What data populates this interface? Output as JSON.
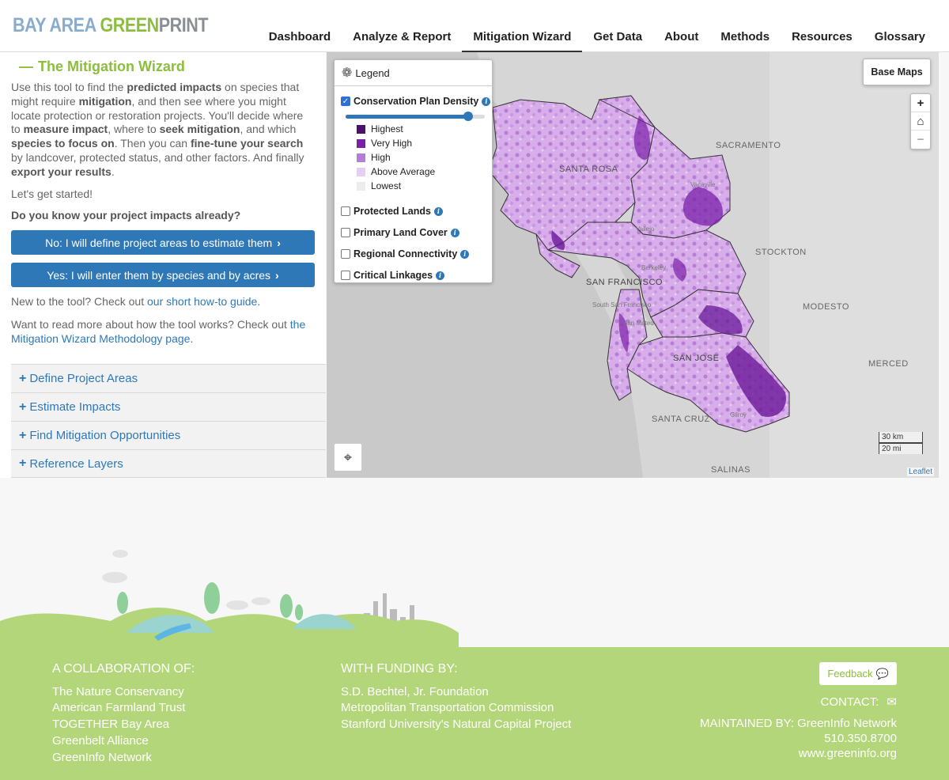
{
  "header": {
    "logo": {
      "part1": "BAY AREA ",
      "part2": "GREEN",
      "part3": "PRINT"
    },
    "nav": [
      {
        "label": "Dashboard"
      },
      {
        "label": "Analyze & Report"
      },
      {
        "label": "Mitigation Wizard"
      },
      {
        "label": "Get Data"
      },
      {
        "label": "About"
      },
      {
        "label": "Methods"
      },
      {
        "label": "Resources"
      },
      {
        "label": "Glossary"
      }
    ],
    "active_nav": "Mitigation Wizard"
  },
  "sidebar": {
    "title": "The Mitigation Wizard",
    "intro": {
      "t1": "Use this tool to find the ",
      "b1": "predicted impacts",
      "t2": " on species that might require ",
      "b2": "mitigation",
      "t3": ", and then see where you might locate protection or restoration projects. You'll decide where to ",
      "b3": "measure impact",
      "t4": ", where to ",
      "b4": "seek mitigation",
      "t5": ", and which ",
      "b5": "species to focus on",
      "t6": ". Then you can ",
      "b6": "fine-tune your search",
      "t7": " by landcover, protected status, and other factors. And finally ",
      "b7": "export your results",
      "t8": "."
    },
    "lets_start": "Let's get started!",
    "question": "Do you know your project impacts already?",
    "btn_no": "No: I will define project areas to estimate them",
    "btn_yes": "Yes: I will enter them by species and by acres",
    "new_text": "New to the tool? Check out ",
    "new_link": "our short how-to guide",
    "new_end": ".",
    "read_text": "Want to read more about how the tool works? Check out ",
    "read_link": "the Mitigation Wizard Methodology page",
    "read_end": ".",
    "accordions": [
      {
        "label": "Define Project Areas"
      },
      {
        "label": "Estimate Impacts"
      },
      {
        "label": "Find Mitigation Opportunities"
      },
      {
        "label": "Reference Layers"
      }
    ]
  },
  "map": {
    "legend": {
      "title": "Legend",
      "layer_main": "Conservation Plan Density",
      "density_slider_value": 0.88,
      "swatches": [
        {
          "label": "Highest",
          "color": "#4b0f6e"
        },
        {
          "label": "Very High",
          "color": "#7a1fa8"
        },
        {
          "label": "High",
          "color": "#b37ed4"
        },
        {
          "label": "Above Average",
          "color": "#e6cdf2"
        },
        {
          "label": "Lowest",
          "color": "#ececec"
        }
      ],
      "layers": [
        {
          "label": "Protected Lands"
        },
        {
          "label": "Primary Land Cover"
        },
        {
          "label": "Regional Connectivity"
        },
        {
          "label": "Critical Linkages"
        }
      ]
    },
    "base_maps": "Base Maps",
    "zoom_in": "+",
    "zoom_out": "−",
    "home_icon": "home-icon",
    "scale_km": "30 km",
    "scale_mi": "20 mi",
    "attribution": "Leaflet",
    "cities": [
      "SACRAMENTO",
      "SANTA ROSA",
      "STOCKTON",
      "SAN FRANCISCO",
      "MODESTO",
      "SAN JOSE",
      "MERCED",
      "SANTA CRUZ",
      "SALINAS"
    ],
    "towns": [
      "Vacaville",
      "Vallejo",
      "Berkeley",
      "South San Francisco",
      "San Mateo",
      "Gilroy"
    ]
  },
  "footer": {
    "collab_head": "A COLLABORATION OF:",
    "collab": [
      "The Nature Conservancy",
      "American Farmland Trust",
      "TOGETHER Bay Area",
      "Greenbelt Alliance",
      "GreenInfo Network"
    ],
    "funding_head": "WITH FUNDING BY:",
    "funding": [
      "S.D. Bechtel, Jr. Foundation",
      "Metropolitan Transportation Commission",
      "Stanford University's Natural Capital Project"
    ],
    "feedback": "Feedback",
    "contact": "CONTACT:",
    "maintained": "MAINTAINED BY: GreenInfo Network",
    "phone": "510.350.8700",
    "website": "www.greeninfo.org"
  },
  "colors": {
    "brand_green": "#8cbd3f",
    "link_blue": "#2f78b7",
    "footer_green": "#b3d67a"
  }
}
